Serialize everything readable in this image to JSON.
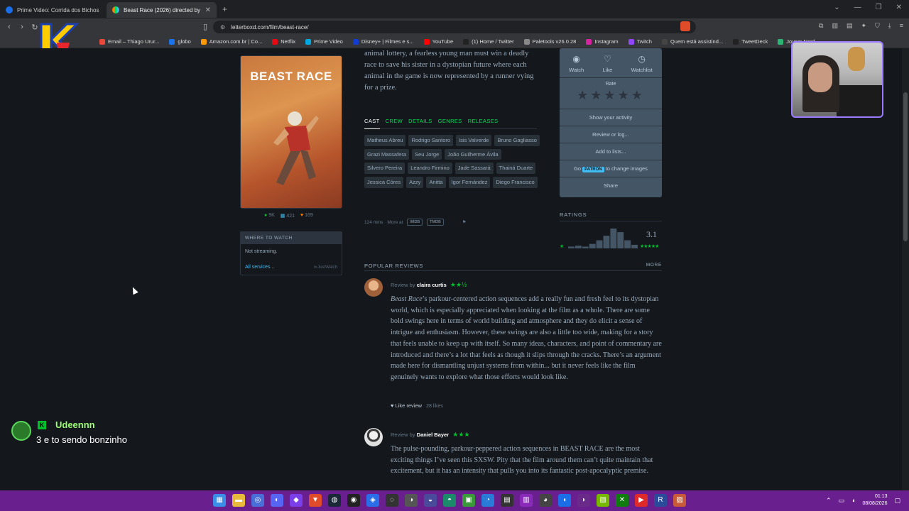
{
  "browser": {
    "tabs": [
      {
        "title": "Prime Video: Corrida dos Bichos",
        "active": false,
        "color": "#1a6ee8"
      },
      {
        "title": "Beast Race (2026) directed by Fe",
        "active": true,
        "color": "#00c030"
      }
    ],
    "url": "letterboxd.com/film/beast-race/",
    "bookmarks": [
      {
        "label": "Email – Thiago Urur...",
        "color": "#e7483a"
      },
      {
        "label": "globo",
        "color": "#1a73e8"
      },
      {
        "label": "Amazon.com.br | Co...",
        "color": "#ff9900"
      },
      {
        "label": "Netflix",
        "color": "#e50914"
      },
      {
        "label": "Prime Video",
        "color": "#00a8e1"
      },
      {
        "label": "Disney+ | Filmes e s...",
        "color": "#113ccf"
      },
      {
        "label": "YouTube",
        "color": "#ff0000"
      },
      {
        "label": "(1) Home / Twitter",
        "color": "#222222"
      },
      {
        "label": "Paletools v26.0.28",
        "color": "#888888"
      },
      {
        "label": "Instagram",
        "color": "#d6249f"
      },
      {
        "label": "Twitch",
        "color": "#9146ff"
      },
      {
        "label": "Quem está assistind...",
        "color": "#444444"
      },
      {
        "label": "TweetDeck",
        "color": "#222222"
      },
      {
        "label": "Jovem Nerd -",
        "color": "#2bb673"
      }
    ]
  },
  "film": {
    "poster_title": "BEAST RACE",
    "stats": {
      "watched": "9K",
      "lists": "421",
      "likes": "169"
    },
    "synopsis": "animal lottery, a fearless young man must win a deadly race to save his sister in a dystopian future where each animal in the game is now represented by a runner vying for a prize.",
    "tabs": [
      "CAST",
      "CREW",
      "DETAILS",
      "GENRES",
      "RELEASES"
    ],
    "cast": [
      "Matheus Abreu",
      "Rodrigo Santoro",
      "Isis Valverde",
      "Bruno Gagliasso",
      "Grazi Massafera",
      "Seu Jorge",
      "João Guilherme Ávila",
      "Silvero Pereira",
      "Leandro Firmino",
      "Jade Sassará",
      "Thainá Duarte",
      "Jessica Córes",
      "Azzy",
      "Anitta",
      "Igor Fernández",
      "Diego Francisco"
    ],
    "runtime": "124 mins",
    "more_at": "More at",
    "imdb": "IMDB",
    "tmdb": "TMDB"
  },
  "where_to_watch": {
    "heading": "WHERE TO WATCH",
    "status": "Not streaming.",
    "all_services": "All services...",
    "provider": "JustWatch"
  },
  "actions": {
    "watch": "Watch",
    "like": "Like",
    "watchlist": "Watchlist",
    "rate": "Rate",
    "items": [
      "Show your activity",
      "Review or log...",
      "Add to lists..."
    ],
    "patron_pre": "Go",
    "patron_badge": "PATRON",
    "patron_post": "to change images",
    "share": "Share"
  },
  "ratings": {
    "label": "RATINGS",
    "average": "3.1",
    "low_star": "★",
    "high_stars": "★★★★★",
    "histogram": [
      2,
      3,
      2,
      5,
      9,
      14,
      22,
      18,
      9,
      4
    ]
  },
  "popular_reviews": {
    "heading": "POPULAR REVIEWS",
    "more": "MORE",
    "reviews": [
      {
        "by_prefix": "Review by",
        "author": "claira curtis",
        "stars": "★★½",
        "avatar_color": "#c98a5a",
        "title_italic": "Beast Race",
        "body": "’s parkour-centered action sequences add a really fun and fresh feel to its dystopian world, which is especially appreciated when looking at the film as a whole. There are some bold swings here in terms of world building and atmosphere and they do elicit a sense of intrigue and enthusiasm. However, these swings are also a little too wide, making for a story that feels unable to keep up with itself. So many ideas, characters, and point of commentary are introduced and there’s a lot that feels as though it slips through the cracks. There’s an argument made here for dismantling unjust systems from within... but it never feels like the film genuinely wants to explore what those efforts would look like.",
        "like_label": "Like review",
        "likes": "28 likes"
      },
      {
        "by_prefix": "Review by",
        "author": "Daniel Bayer",
        "stars": "★★★",
        "avatar_color": "#d9d9d9",
        "title_italic": "",
        "body": "The pulse-pounding, parkour-peppered action sequences in BEAST RACE are the most exciting things I’ve seen this SXSW. Pity that the film around them can’t quite maintain that excitement, but it has an intensity that pulls you into its fantastic post-apocalyptic premise.",
        "like_label": "",
        "likes": ""
      }
    ]
  },
  "chat": {
    "badge": "K",
    "username": "Udeennn",
    "message": "3 e to sendo bonzinho"
  },
  "taskbar": {
    "time": "01:13",
    "date": "08/08/2026"
  }
}
